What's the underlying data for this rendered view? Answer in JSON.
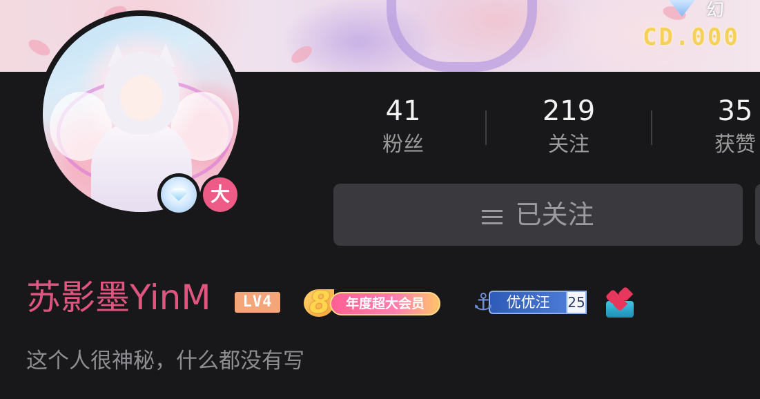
{
  "banner": {
    "label": "幻",
    "code": "CD.000"
  },
  "profile": {
    "vip_icon": "diamond-icon",
    "big_member_label": "大"
  },
  "stats": [
    {
      "value": "41",
      "label": "粉丝"
    },
    {
      "value": "219",
      "label": "关注"
    },
    {
      "value": "35",
      "label": "获赞"
    }
  ],
  "actions": {
    "follow_label": "已关注",
    "follow_icon": "menu-icon"
  },
  "user": {
    "name": "苏影墨YinM",
    "level": "LV4",
    "annual_vip_number": "8",
    "annual_vip_label": "年度超大会员",
    "fan_badge_name": "优优汪",
    "fan_badge_level": "25",
    "bio": "这个人很神秘，什么都没有写"
  },
  "colors": {
    "background": "#18181a",
    "username": "#e0557f",
    "button_bg": "#3a3a3e",
    "level_badge": "#f5a57a"
  }
}
